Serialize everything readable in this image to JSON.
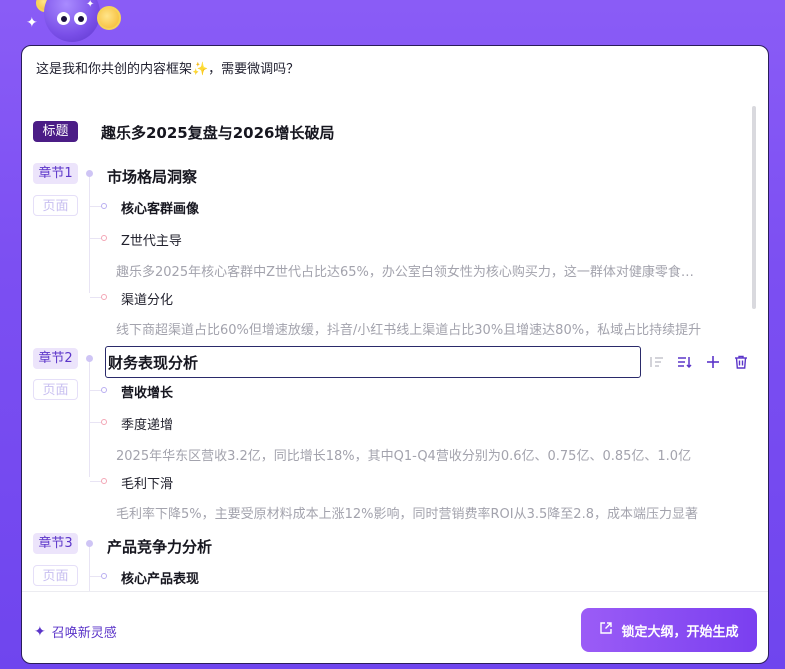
{
  "intro_text": "这是我和你共创的内容框架✨，需要微调吗？",
  "title": {
    "tag": "标题",
    "text": "趣乐多2025复盘与2026增长破局"
  },
  "chapters": [
    {
      "tag": "章节1",
      "page_tag": "页面",
      "title": "市场格局洞察",
      "subsection": "核心客群画像",
      "points": [
        {
          "title": "Z世代主导",
          "desc": "趣乐多2025年核心客群中Z世代占比达65%，办公室白领女性为核心购买力，这一群体对健康零食和个性化包装需求旺盛"
        },
        {
          "title": "渠道分化",
          "desc": "线下商超渠道占比60%但增速放缓，抖音/小红书线上渠道占比30%且增速达80%，私域占比持续提升"
        }
      ]
    },
    {
      "tag": "章节2",
      "page_tag": "页面",
      "title": "财务表现分析",
      "subsection": "营收增长",
      "points": [
        {
          "title": "季度递增",
          "desc": "2025年华东区营收3.2亿，同比增长18%，其中Q1-Q4营收分别为0.6亿、0.75亿、0.85亿、1.0亿"
        },
        {
          "title": "毛利下滑",
          "desc": "毛利率下降5%，主要受原材料成本上涨12%影响，同时营销费率ROI从3.5降至2.8，成本端压力显著"
        }
      ]
    },
    {
      "tag": "章节3",
      "page_tag": "页面",
      "title": "产品竞争力分析",
      "subsection": "核心产品表现"
    }
  ],
  "footer": {
    "summon_label": "召唤新灵感",
    "lock_label": "锁定大纲，开始生成"
  }
}
